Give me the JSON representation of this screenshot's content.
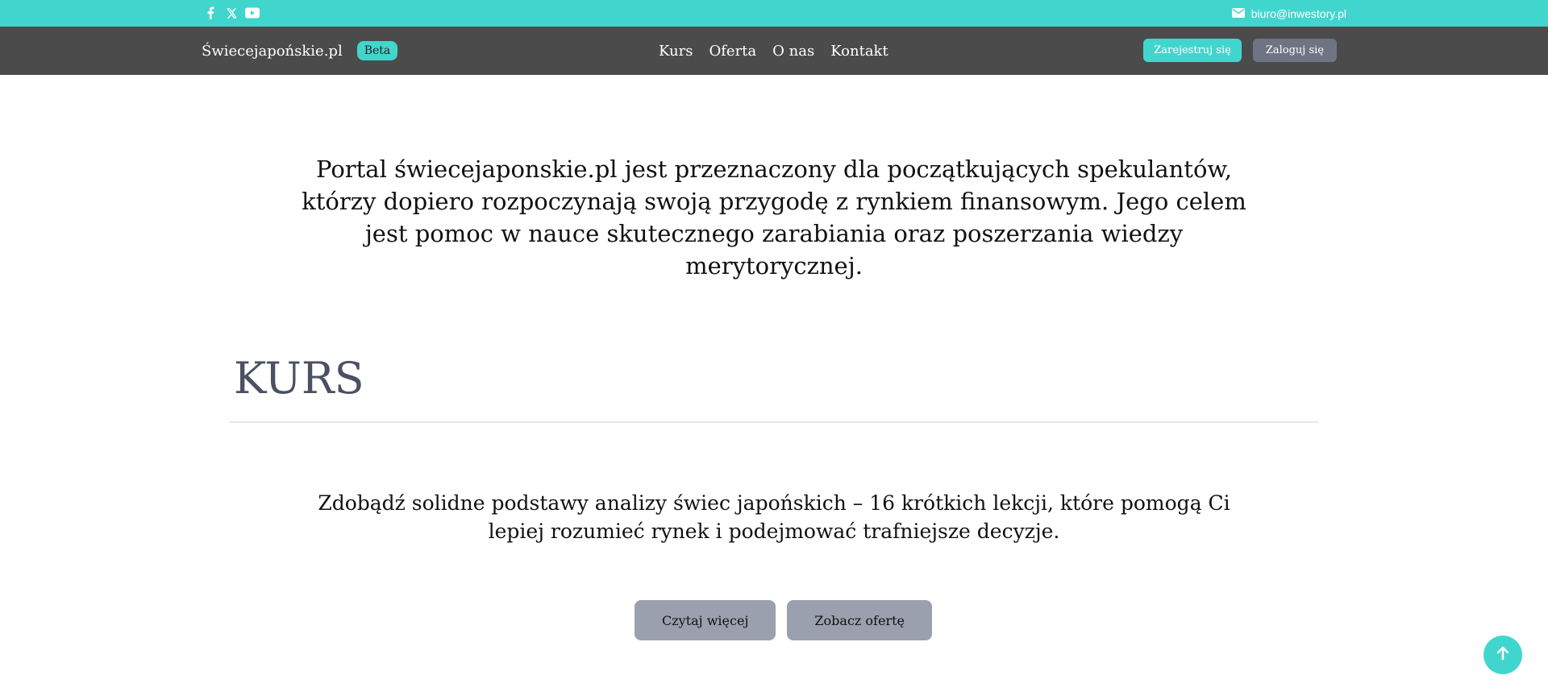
{
  "topbar": {
    "social_icons": [
      "facebook-icon",
      "x-icon",
      "youtube-icon"
    ],
    "email": "biuro@inwestory.pl",
    "bg_color": "#41d6cd"
  },
  "navbar": {
    "brand": "Świecejapońskie.pl",
    "badge": "Beta",
    "menu": [
      "Kurs",
      "Oferta",
      "O nas",
      "Kontakt"
    ],
    "register": "Zarejestruj się",
    "login": "Zaloguj się",
    "bg_color": "#4b4b4b"
  },
  "intro": {
    "text": "Portal świecejaponskie.pl jest przeznaczony dla początkujących spekulantów, którzy dopiero rozpoczynają swoją przygodę z rynkiem finansowym. Jego celem jest pomoc w nauce skutecznego zarabiania oraz poszerzania wiedzy merytorycznej."
  },
  "section": {
    "title": "KURS",
    "description": "Zdobądź solidne podstawy analizy świec japońskich – 16 krótkich lekcji, które pomogą Ci lepiej rozumieć rynek i podejmować trafniejsze decyzje.",
    "buttons": [
      "Czytaj więcej",
      "Zobacz ofertę"
    ]
  },
  "scroll_top": {
    "icon": "arrow-up-icon"
  }
}
